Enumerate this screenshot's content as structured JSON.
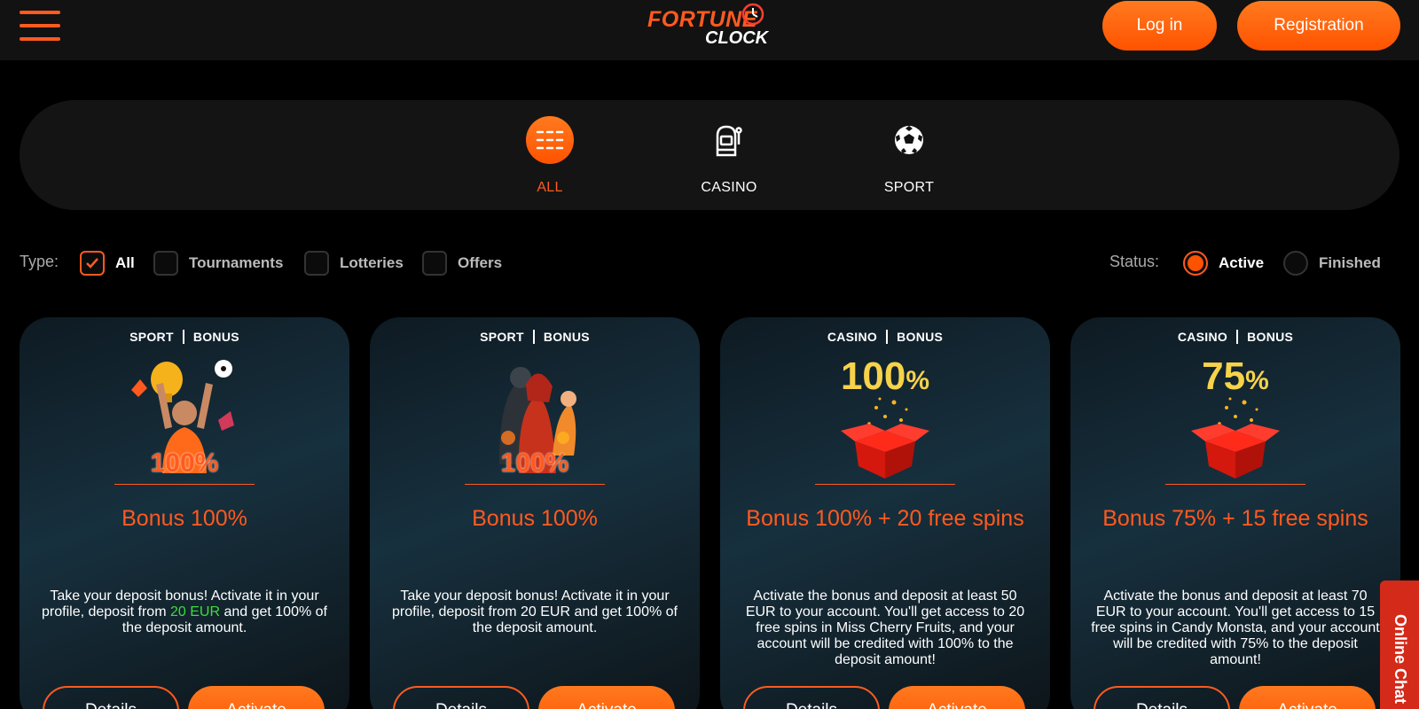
{
  "header": {
    "logo_line1": "FORTUNE",
    "logo_line2": "CLOCK",
    "login_label": "Log in",
    "register_label": "Registration"
  },
  "categories": [
    {
      "label": "ALL",
      "icon": "grid-icon",
      "active": true
    },
    {
      "label": "CASINO",
      "icon": "slot-machine-icon",
      "active": false
    },
    {
      "label": "SPORT",
      "icon": "soccer-ball-icon",
      "active": false
    }
  ],
  "filters": {
    "type_label": "Type:",
    "types": [
      {
        "label": "All",
        "checked": true
      },
      {
        "label": "Tournaments",
        "checked": false
      },
      {
        "label": "Lotteries",
        "checked": false
      },
      {
        "label": "Offers",
        "checked": false
      }
    ],
    "status_label": "Status:",
    "statuses": [
      {
        "label": "Active",
        "selected": true
      },
      {
        "label": "Finished",
        "selected": false
      }
    ]
  },
  "cards": [
    {
      "tag1": "SPORT",
      "tag2": "BONUS",
      "art_text": "100%",
      "title": "Bonus 100%",
      "desc_pre": "Take your deposit bonus! Activate it in your profile, deposit from ",
      "desc_highlight": "20 EUR",
      "desc_post": " and get 100% of the deposit amount.",
      "details_label": "Details",
      "activate_label": "Activate"
    },
    {
      "tag1": "SPORT",
      "tag2": "BONUS",
      "art_text": "100%",
      "title": "Bonus 100%",
      "desc": "Take your deposit bonus! Activate it in your profile, deposit from 20 EUR and get 100% of the deposit amount.",
      "details_label": "Details",
      "activate_label": "Activate"
    },
    {
      "tag1": "CASINO",
      "tag2": "BONUS",
      "art_number": "100",
      "art_pct": "%",
      "title": "Bonus 100% + 20 free spins",
      "desc": "Activate the bonus and deposit at least 50 EUR to your account. You'll get access to 20 free spins in Miss Cherry Fruits, and your account will be credited with 100% to the deposit amount!",
      "details_label": "Details",
      "activate_label": "Activate"
    },
    {
      "tag1": "CASINO",
      "tag2": "BONUS",
      "art_number": "75",
      "art_pct": "%",
      "title": "Bonus 75% + 15 free spins",
      "desc": "Activate the bonus and deposit at least 70 EUR to your account. You'll get access to 15 free spins in Candy Monsta, and your account will be credited with 75% to the deposit amount!",
      "details_label": "Details",
      "activate_label": "Activate"
    }
  ],
  "chat_label": "Online Chat",
  "colors": {
    "accent": "#ff5a1f",
    "background": "#000000",
    "header_bg": "#121212",
    "highlight_green": "#3ddc3d",
    "chat_red": "#d42a1a"
  }
}
